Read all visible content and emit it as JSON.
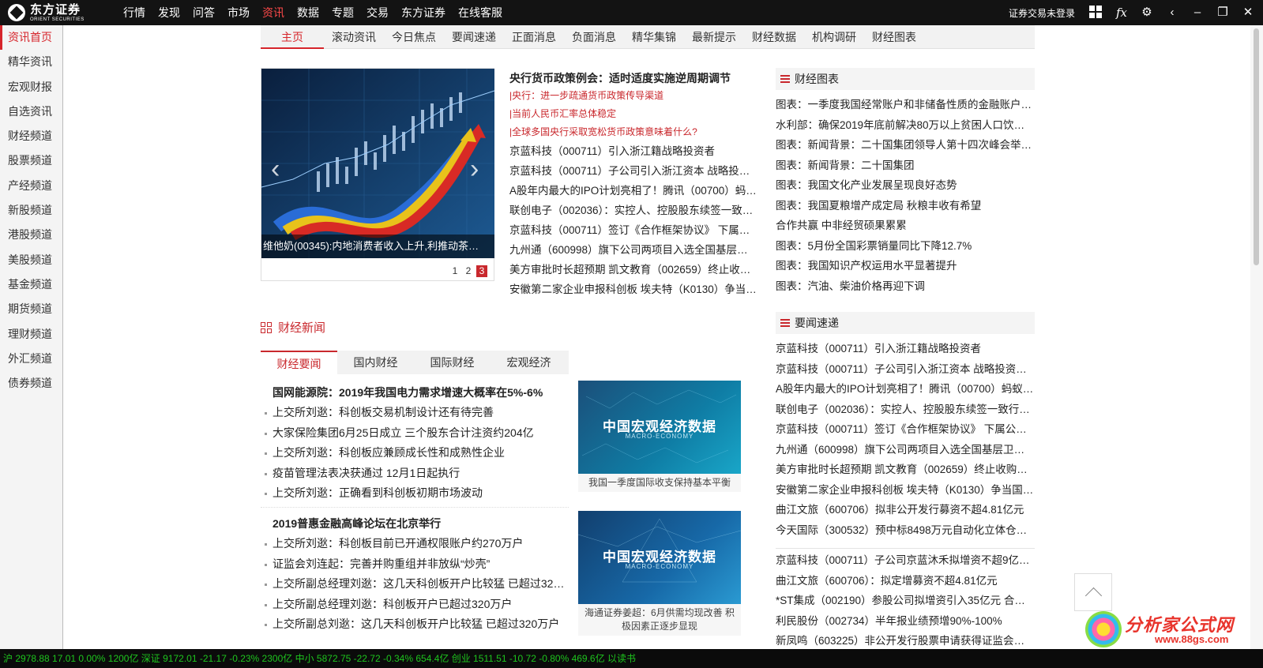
{
  "app": {
    "logo_cn": "东方证券",
    "logo_en": "ORIENT SECURITIES"
  },
  "topnav": [
    "行情",
    "发现",
    "问答",
    "市场",
    "资讯",
    "数据",
    "专题",
    "交易",
    "东方证券",
    "在线客服"
  ],
  "topnav_active": 4,
  "topright": {
    "login_status": "证券交易未登录",
    "icons": [
      "grid-icon",
      "fx-icon",
      "gear-icon",
      "back-icon",
      "minimize-icon",
      "restore-icon",
      "close-icon"
    ]
  },
  "sidebar": [
    "资讯首页",
    "精华资讯",
    "宏观财报",
    "自选资讯",
    "财经频道",
    "股票频道",
    "产经频道",
    "新股频道",
    "港股频道",
    "美股频道",
    "基金频道",
    "期货频道",
    "理财频道",
    "外汇频道",
    "债券频道"
  ],
  "subnav": [
    "主页",
    "滚动资讯",
    "今日焦点",
    "要闻速递",
    "正面消息",
    "负面消息",
    "精华集锦",
    "最新提示",
    "财经数据",
    "机构调研",
    "财经图表"
  ],
  "carousel": {
    "caption": "维他奶(00345):内地消费者收入上升,利推动茶…",
    "pages": [
      "1",
      "2",
      "3"
    ],
    "active_page": 3
  },
  "headline": {
    "title": "央行货币政策例会：适时适度实施逆周期调节",
    "subs": [
      "|央行：进一步疏通货币政策传导渠道",
      "|当前人民币汇率总体稳定",
      "|全球多国央行采取宽松货币政策意味着什么?"
    ],
    "news": [
      "京蓝科技（000711）引入浙江籍战略投资者",
      "京蓝科技（000711）子公司引入浙江资本 战略投…",
      "A股年内最大的IPO计划亮相了！腾讯（00700）蚂…",
      "联创电子（002036）：实控人、控股股东续签一致…",
      "京蓝科技（000711）签订《合作框架协议》 下属…",
      "九州通（600998）旗下公司两项目入选全国基层卫…",
      "美方审批时长超预期 凯文教育（002659）终止收…",
      "安徽第二家企业申报科创板 埃夫特（K0130）争当…"
    ]
  },
  "caijing": {
    "title": "财经新闻",
    "tabs": [
      "财经要闻",
      "国内财经",
      "国际财经",
      "宏观经济"
    ],
    "active_tab": 0,
    "block1": {
      "title": "国网能源院：2019年我国电力需求增速大概率在5%-6%",
      "items": [
        "上交所刘逖：科创板交易机制设计还有待完善",
        "大家保险集团6月25日成立 三个股东合计注资约204亿",
        "上交所刘逖：科创板应兼顾成长性和成熟性企业",
        "疫苗管理法表决获通过 12月1日起执行",
        "上交所刘逖：正确看到科创板初期市场波动"
      ]
    },
    "block2": {
      "title": "2019普惠金融高峰论坛在北京举行",
      "items": [
        "上交所刘逖：科创板目前已开通权限账户约270万户",
        "证监会刘连起：完善并购重组并非放纵“炒壳”",
        "上交所副总经理刘逖：这几天科创板开户比较猛 已超过320…",
        "上交所副总经理刘逖：科创板开户已超过320万户",
        "上交所副总刘逖：这几天科创板开户比较猛 已超过320万户"
      ]
    },
    "macro_cards": [
      {
        "title": "中国宏观经济数据",
        "subtitle": "MACRO-ECONOMY",
        "caption": "我国一季度国际收支保持基本平衡"
      },
      {
        "title": "中国宏观经济数据",
        "subtitle": "MACRO-ECONOMY",
        "caption": "海通证券姜超：6月供需均现改善 积极因素正逐步显现"
      }
    ]
  },
  "right": {
    "charts_title": "财经图表",
    "charts": [
      "图表：一季度我国经常账户和非储备性质的金融账户…",
      "水利部：确保2019年底前解决80万以上贫困人口饮水…",
      "图表：新闻背景：二十国集团领导人第十四次峰会举…",
      "图表：新闻背景：二十国集团",
      "图表：我国文化产业发展呈现良好态势",
      "图表：我国夏粮增产成定局 秋粮丰收有希望",
      "合作共赢 中非经贸硕果累累",
      "图表：5月份全国彩票销量同比下降12.7%",
      "图表：我国知识产权运用水平显著提升",
      "图表：汽油、柴油价格再迎下调"
    ],
    "news_title": "要闻速递",
    "news1": [
      "京蓝科技（000711）引入浙江籍战略投资者",
      "京蓝科技（000711）子公司引入浙江资本 战略投资…",
      "A股年内最大的IPO计划亮相了！腾讯（00700）蚂蚁…",
      "联创电子（002036）：实控人、控股股东续签一致行…",
      "京蓝科技（000711）签订《合作框架协议》 下属公…",
      "九州通（600998）旗下公司两项目入选全国基层卫生…",
      "美方审批时长超预期 凯文教育（002659）终止收购…",
      "安徽第二家企业申报科创板 埃夫特（K0130）争当国…",
      "曲江文旅（600706）拟非公开发行募资不超4.81亿元",
      "今天国际（300532）预中标8498万元自动化立体仓库…"
    ],
    "news2": [
      "京蓝科技（000711）子公司京蓝沐禾拟增资不超9亿…",
      "曲江文旅（600706）：拟定增募资不超4.81亿元",
      "*ST集成（002190）参股公司拟增资引入35亿元 合作…",
      "利民股份（002734）半年报业绩预增90%-100%",
      "新凤鸣（603225）非公开发行股票申请获得证监会审…"
    ]
  },
  "watermark": {
    "text": "分析家公式网",
    "url": "www.88gs.com"
  },
  "ticker": "沪 2978.88  17.01  0.00%  1200亿    深证 9172.01  -21.17  -0.23%  2300亿    中小 5872.75  -22.72  -0.34%  654.4亿    创业 1511.51  -10.72  -0.80%  469.6亿    以读书",
  "colors": {
    "accent": "#c9282d",
    "topbar": "#131313"
  }
}
